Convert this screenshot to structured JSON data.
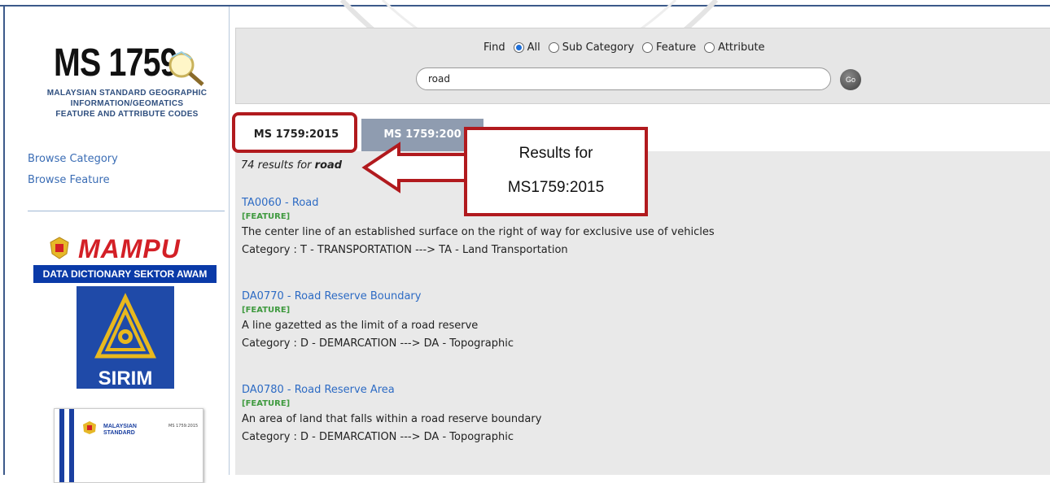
{
  "sidebar": {
    "logo_title": "MS 1759",
    "logo_sub_line1": "MALAYSIAN STANDARD GEOGRAPHIC",
    "logo_sub_line2": "INFORMATION/GEOMATICS",
    "logo_sub_line3": "FEATURE AND ATTRIBUTE CODES",
    "links": [
      "Browse Category",
      "Browse Feature"
    ],
    "mampu_text": "MAMPU",
    "mampu_banner": "DATA DICTIONARY SEKTOR AWAM",
    "sirim_text": "SIRIM",
    "card_text_line1": "MALAYSIAN",
    "card_text_line2": "STANDARD",
    "card_code": "MS 1759:2015"
  },
  "search": {
    "find_label": "Find",
    "options": [
      "All",
      "Sub Category",
      "Feature",
      "Attribute"
    ],
    "selected": "All",
    "query": "road",
    "go_label": "Go"
  },
  "tabs": [
    "MS 1759:2015",
    "MS 1759:200"
  ],
  "results": {
    "count_prefix": "74 results for",
    "term": "road",
    "items": [
      {
        "title": "TA0060 - Road",
        "type": "[FEATURE]",
        "description": "The center line of an established surface on the right of way for exclusive use of vehicles",
        "category": "Category : T - TRANSPORTATION ---> TA - Land Transportation"
      },
      {
        "title": "DA0770 - Road Reserve Boundary",
        "type": "[FEATURE]",
        "description": "A line gazetted as the limit of a road reserve",
        "category": "Category : D - DEMARCATION ---> DA - Topographic"
      },
      {
        "title": "DA0780 - Road Reserve Area",
        "type": "[FEATURE]",
        "description": "An area of land that falls within a road reserve boundary",
        "category": "Category : D - DEMARCATION ---> DA - Topographic"
      }
    ]
  },
  "annotation": {
    "line1": "Results for",
    "line2": "MS1759:2015"
  },
  "colors": {
    "link": "#2d6bc4",
    "annotation_red": "#b11a1e",
    "feature_green": "#3f9a3f"
  }
}
